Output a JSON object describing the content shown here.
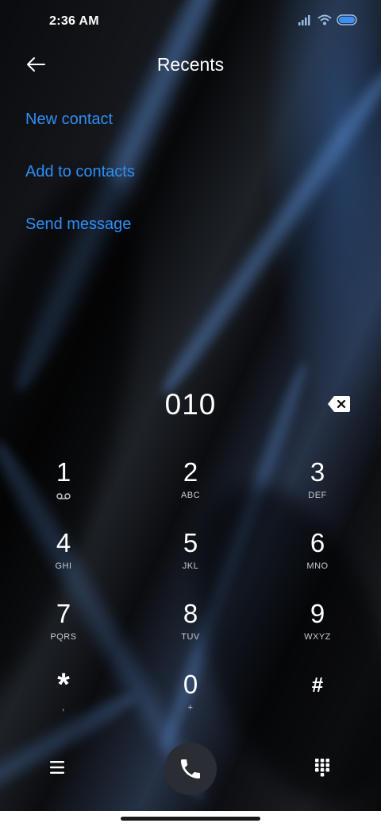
{
  "status_bar": {
    "time": "2:36 AM"
  },
  "header": {
    "title": "Recents"
  },
  "menu": [
    {
      "label": "New contact"
    },
    {
      "label": "Add to contacts"
    },
    {
      "label": "Send message"
    }
  ],
  "dialer": {
    "number": "010"
  },
  "keys": [
    {
      "digit": "1",
      "letters": ""
    },
    {
      "digit": "2",
      "letters": "ABC"
    },
    {
      "digit": "3",
      "letters": "DEF"
    },
    {
      "digit": "4",
      "letters": "GHI"
    },
    {
      "digit": "5",
      "letters": "JKL"
    },
    {
      "digit": "6",
      "letters": "MNO"
    },
    {
      "digit": "7",
      "letters": "PQRS"
    },
    {
      "digit": "8",
      "letters": "TUV"
    },
    {
      "digit": "9",
      "letters": "WXYZ"
    },
    {
      "digit": "*",
      "letters": ","
    },
    {
      "digit": "0",
      "letters": "+"
    },
    {
      "digit": "#",
      "letters": ""
    }
  ],
  "icons": {
    "back": "arrow-left-icon",
    "backspace": "backspace-icon",
    "voicemail": "voicemail-icon",
    "menu": "hamburger-menu-icon",
    "call": "phone-icon",
    "dialpad": "dialpad-icon"
  },
  "colors": {
    "accent": "#2f8ef5",
    "call_button": "#2a2e34"
  }
}
